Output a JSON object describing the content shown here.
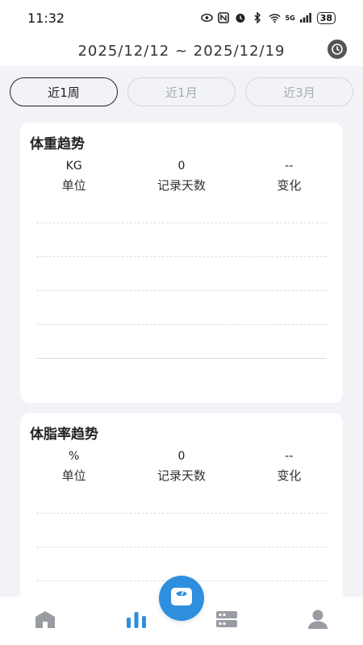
{
  "status_bar": {
    "time": "11:32",
    "network": "5G",
    "battery": "38"
  },
  "header": {
    "date_range": "2025/12/12 ~ 2025/12/19",
    "history_icon": "clock-icon"
  },
  "tabs": [
    {
      "label": "近1周",
      "active": true
    },
    {
      "label": "近1月",
      "active": false
    },
    {
      "label": "近3月",
      "active": false
    }
  ],
  "weight_card": {
    "title": "体重趋势",
    "stats": [
      {
        "value": "KG",
        "label": "单位"
      },
      {
        "value": "0",
        "label": "记录天数"
      },
      {
        "value": "--",
        "label": "变化"
      }
    ]
  },
  "body_fat_card": {
    "title": "体脂率趋势",
    "stats": [
      {
        "value": "%",
        "label": "单位"
      },
      {
        "value": "0",
        "label": "记录天数"
      },
      {
        "value": "--",
        "label": "变化"
      }
    ]
  },
  "bottom_nav": {
    "items": [
      "home-icon",
      "chart-bars-icon",
      "device-list-icon",
      "profile-icon"
    ],
    "center_button": "scale-icon",
    "active_index": 1
  },
  "colors": {
    "accent": "#2f8fdf",
    "background": "#f2f3f7",
    "nav_inactive": "#9a9ca3"
  }
}
